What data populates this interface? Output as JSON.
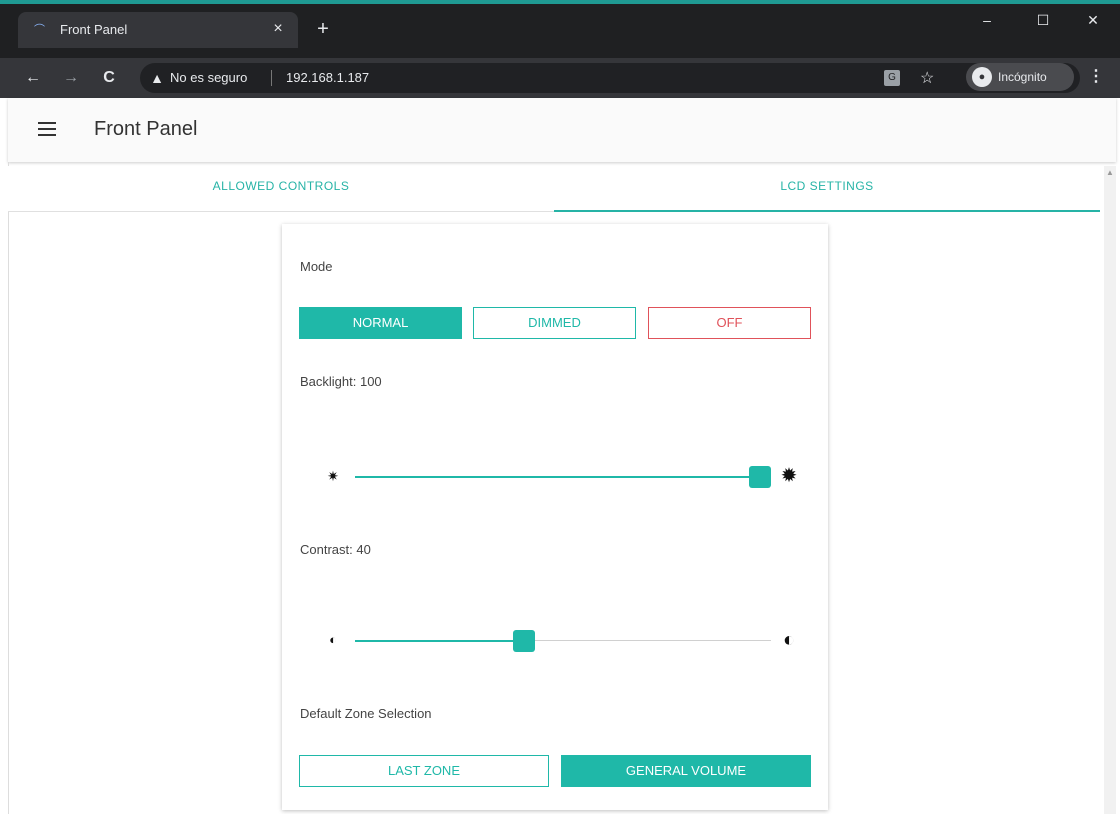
{
  "browser": {
    "tab_title": "Front Panel",
    "tab_close": "×",
    "new_tab": "+",
    "minimize": "–",
    "maximize": "☐",
    "close": "✕",
    "back": "←",
    "forward": "→",
    "reload": "C",
    "security_warning": "No es seguro",
    "url": "192.168.1.187",
    "incognito_label": "Incógnito"
  },
  "appbar": {
    "title": "Front Panel"
  },
  "tabs": [
    {
      "label": "ALLOWED CONTROLS",
      "active": false
    },
    {
      "label": "LCD SETTINGS",
      "active": true
    }
  ],
  "lcd": {
    "mode_label": "Mode",
    "mode_options": [
      "NORMAL",
      "DIMMED",
      "OFF"
    ],
    "mode_selected": "NORMAL",
    "backlight_label": "Backlight: 100",
    "backlight_value": 100,
    "contrast_label": "Contrast: 40",
    "contrast_value": 40,
    "zone_label": "Default Zone Selection",
    "zone_options": [
      "LAST ZONE",
      "GENERAL VOLUME"
    ],
    "zone_selected": "GENERAL VOLUME"
  },
  "colors": {
    "accent": "#1fb8a8",
    "danger": "#e0525a"
  },
  "icons": {
    "backlight_low": "brightness-low-icon",
    "backlight_high": "brightness-high-icon",
    "contrast_low": "contrast-low-icon",
    "contrast_high": "contrast-high-icon"
  }
}
